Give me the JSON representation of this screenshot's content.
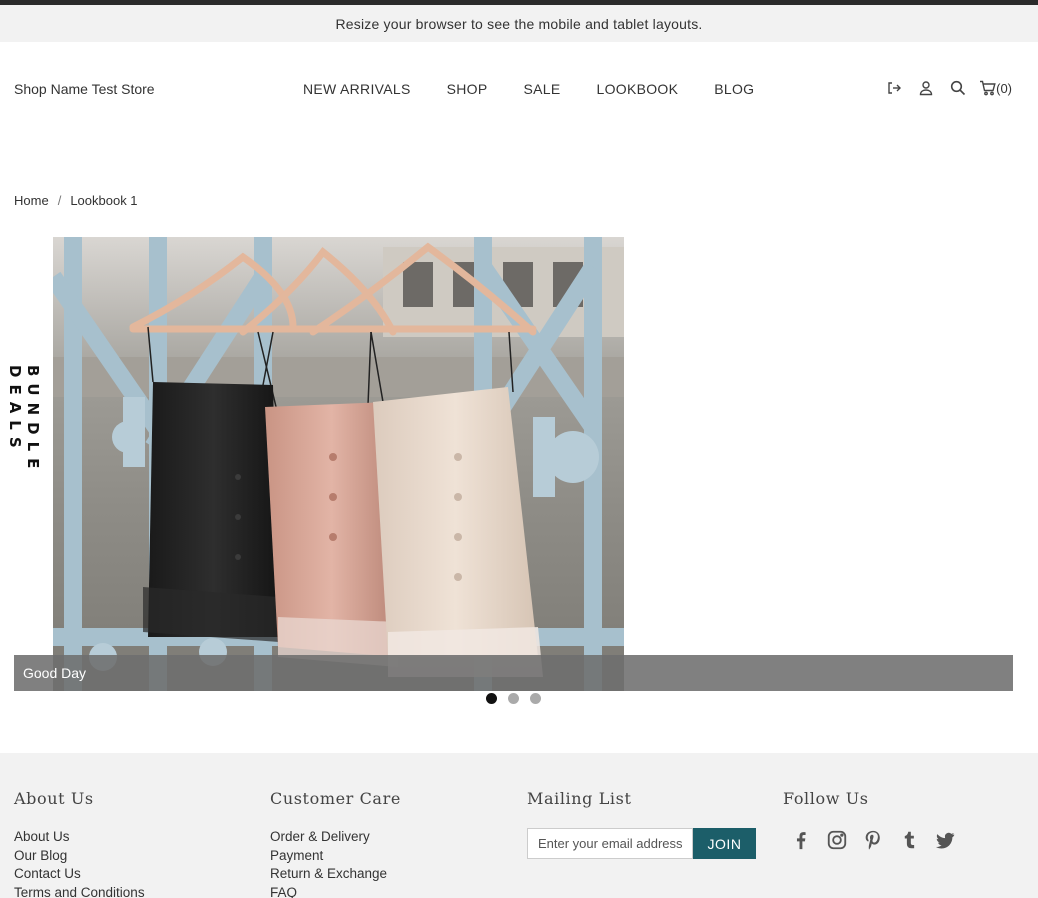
{
  "announcement": "Resize your browser to see the mobile and tablet layouts.",
  "header": {
    "shop_name": "Shop Name Test Store",
    "nav": [
      "NEW ARRIVALS",
      "SHOP",
      "SALE",
      "LOOKBOOK",
      "BLOG"
    ],
    "icons": [
      "logout-icon",
      "user-icon",
      "search-icon",
      "cart-icon"
    ],
    "cart_count": "(0)"
  },
  "breadcrumb": {
    "home": "Home",
    "separator": "/",
    "current": "Lookbook 1"
  },
  "lookbook": {
    "side_banner": "BUNDLE DEALS",
    "caption": "Good Day",
    "slide_count": 3,
    "active_slide": 1
  },
  "footer": {
    "about": {
      "title": "About Us",
      "links": [
        "About Us",
        "Our Blog",
        "Contact Us",
        "Terms and Conditions"
      ]
    },
    "care": {
      "title": "Customer Care",
      "links": [
        "Order & Delivery",
        "Payment",
        "Return & Exchange",
        "FAQ"
      ]
    },
    "mailing": {
      "title": "Mailing List",
      "placeholder": "Enter your email address",
      "button": "JOIN"
    },
    "follow": {
      "title": "Follow Us",
      "icons": [
        "facebook-icon",
        "instagram-icon",
        "pinterest-icon",
        "tumblr-icon",
        "twitter-icon"
      ]
    }
  },
  "colors": {
    "accent": "#1c5e69",
    "footer_bg": "#f2f2f2",
    "announce_bg": "#f2f2f2",
    "topbar": "#2b2b2b"
  }
}
